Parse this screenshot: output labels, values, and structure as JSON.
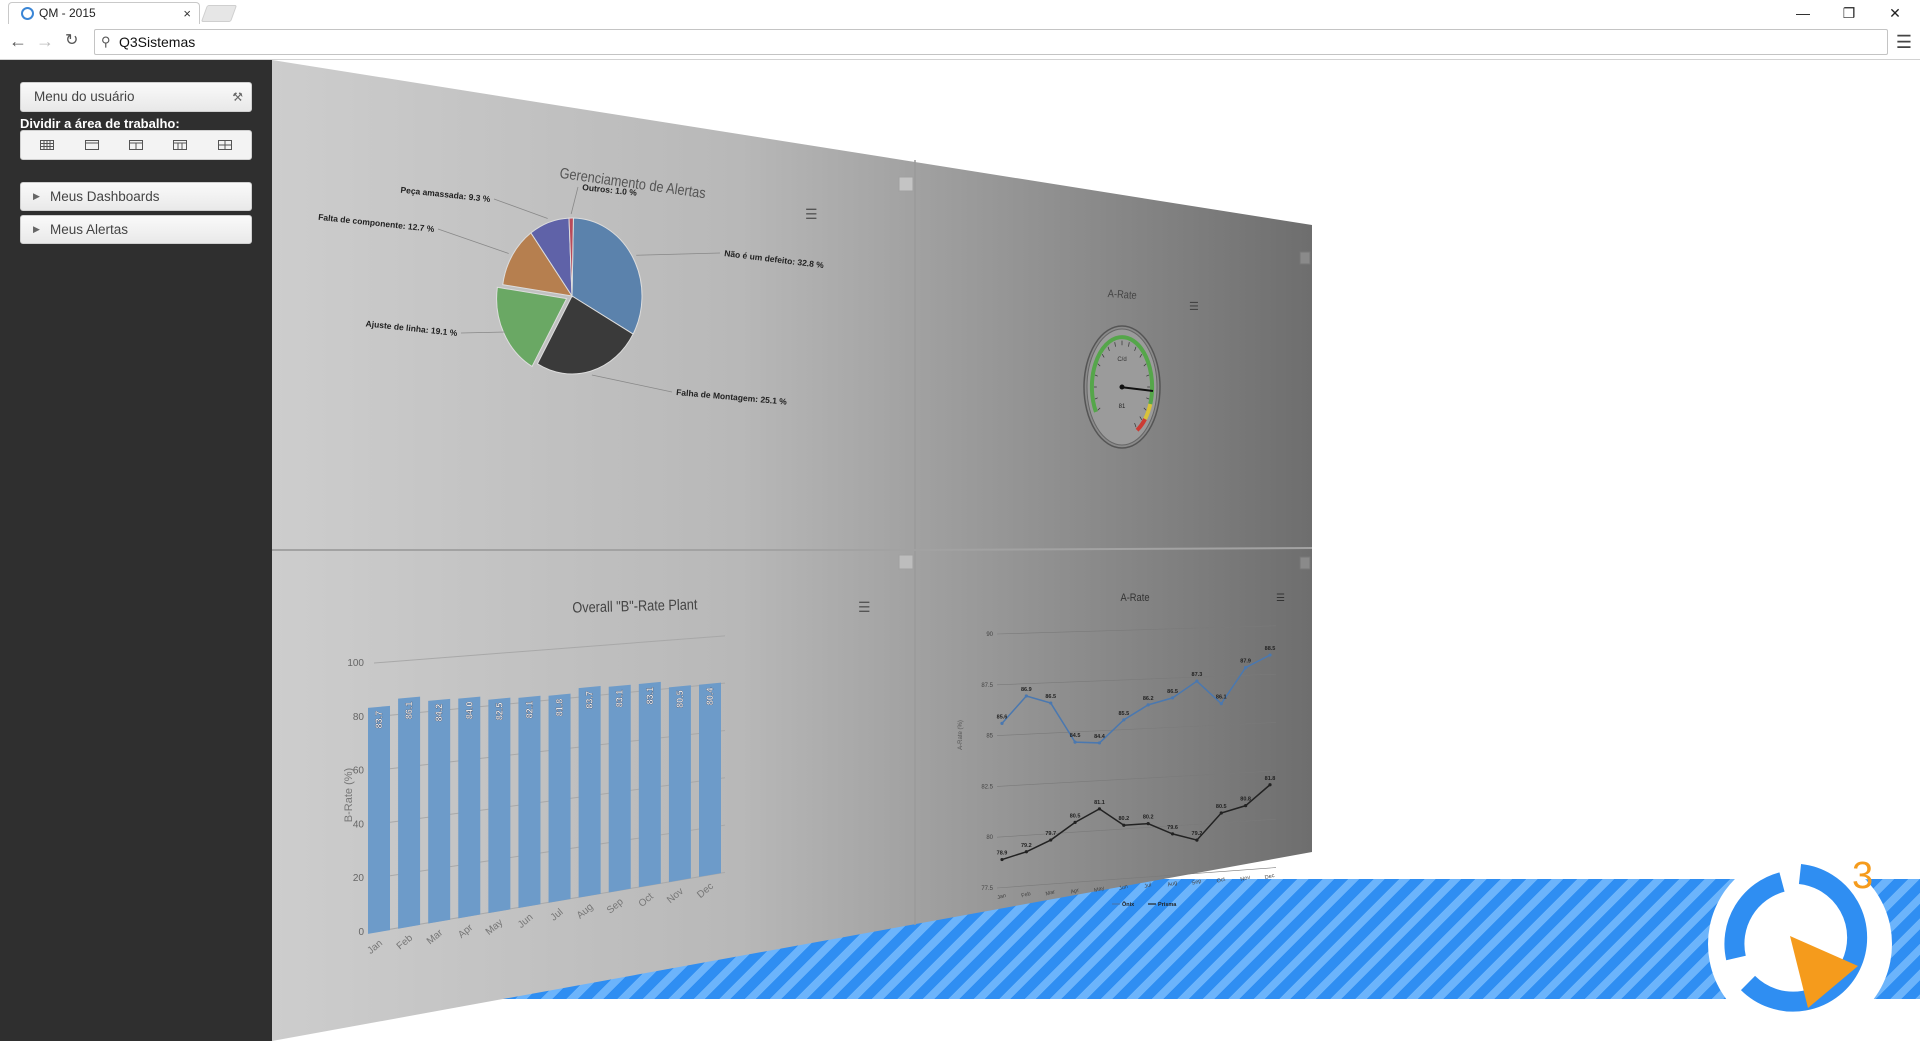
{
  "browser": {
    "tab_title": "QM - 2015",
    "tab_close": "×",
    "address": "Q3Sistemas",
    "window_controls": [
      "minimize-icon",
      "restore-icon",
      "close-icon"
    ]
  },
  "sidebar": {
    "user_menu_label": "Menu do usuário",
    "split_label": "Dividir a área de trabalho:",
    "split_options": [
      "grid-4x3-icon",
      "single-panel-icon",
      "two-columns-icon",
      "three-columns-icon",
      "grid-2x2-icon"
    ],
    "accordion": [
      {
        "label": "Meus Dashboards"
      },
      {
        "label": "Meus Alertas"
      }
    ]
  },
  "panels": {
    "pie": {
      "chart_data": {
        "type": "pie",
        "title": "Gerenciamento de Alertas",
        "slices": [
          {
            "name": "Não é um defeito",
            "value": 32.8,
            "color": "#5b82ac"
          },
          {
            "name": "Falha de Montagem",
            "value": 25.1,
            "color": "#3a3a3a"
          },
          {
            "name": "Ajuste de linha",
            "value": 19.1,
            "color": "#6aa864"
          },
          {
            "name": "Falta de componente",
            "value": 12.7,
            "color": "#b67f4f"
          },
          {
            "name": "Peça amassada",
            "value": 9.3,
            "color": "#5f62a8"
          },
          {
            "name": "Outros",
            "value": 1.0,
            "color": "#b94a5a"
          }
        ],
        "labels": [
          "Não é um defeito: 32.8 %",
          "Falha de Montagem: 25.1 %",
          "Ajuste de linha: 19.1 %",
          "Falta de componente: 12.7 %",
          "Peça amassada: 9.3 %",
          "Outros: 1.0 %"
        ]
      }
    },
    "gauge": {
      "chart_data": {
        "type": "gauge",
        "title": "A-Rate",
        "unit": "C/d",
        "value": 81,
        "value_label": "81",
        "bands": [
          {
            "name": "good",
            "color": "#55a64a"
          },
          {
            "name": "warning",
            "color": "#d8c23a"
          },
          {
            "name": "bad",
            "color": "#cc3b33"
          }
        ]
      }
    },
    "bar": {
      "chart_data": {
        "type": "bar",
        "title": "Overall \"B\"-Rate Plant",
        "ylabel": "B-Rate (%)",
        "ylim": [
          0,
          100
        ],
        "yticks": [
          0,
          20,
          40,
          60,
          80,
          100
        ],
        "categories": [
          "Jan",
          "Feb",
          "Mar",
          "Apr",
          "May",
          "Jun",
          "Jul",
          "Aug",
          "Sep",
          "Oct",
          "Nov",
          "Dec"
        ],
        "values": [
          83.7,
          86.1,
          84.2,
          84.0,
          82.5,
          82.1,
          81.8,
          83.7,
          83.1,
          83.1,
          80.5,
          80.4
        ],
        "value_labels": [
          "83.7",
          "86.1",
          "84.2",
          "84.0",
          "82.5",
          "82.1",
          "81.8",
          "83.7",
          "83.1",
          "83.1",
          "80.5",
          "80.4"
        ],
        "color": "#6d9bc9"
      }
    },
    "line": {
      "chart_data": {
        "type": "line",
        "title": "A-Rate",
        "ylabel": "A-Rate (%)",
        "ylim": [
          77.5,
          90
        ],
        "yticks": [
          "77.5",
          "80",
          "82.5",
          "85",
          "87.5",
          "90"
        ],
        "categories": [
          "Jan",
          "Feb",
          "Mar",
          "Apr",
          "May",
          "Jun",
          "Jul",
          "Aug",
          "Sep",
          "Oct",
          "Nov",
          "Dec"
        ],
        "series": [
          {
            "name": "Ônix",
            "color": "#4a78b0",
            "values": [
              85.6,
              86.9,
              86.5,
              84.5,
              84.4,
              85.5,
              86.2,
              86.5,
              87.3,
              86.1,
              87.9,
              88.5
            ]
          },
          {
            "name": "Prisma",
            "color": "#222222",
            "values": [
              78.9,
              79.2,
              79.7,
              80.5,
              81.1,
              80.2,
              80.2,
              79.6,
              79.2,
              80.5,
              80.8,
              81.8
            ]
          }
        ]
      }
    }
  }
}
